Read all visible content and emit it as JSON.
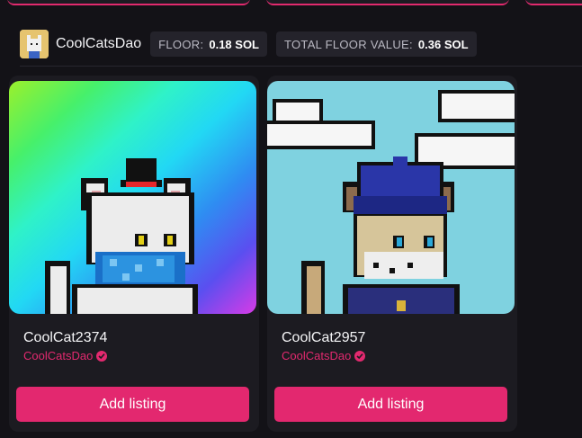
{
  "collection": {
    "name": "CoolCatsDao",
    "avatar_icon": "cool-cat-avatar",
    "stats": [
      {
        "label": "FLOOR:",
        "value": "0.18 SOL"
      },
      {
        "label": "TOTAL FLOOR VALUE:",
        "value": "0.36 SOL"
      }
    ]
  },
  "cards": [
    {
      "title": "CoolCat2374",
      "collection": "CoolCatsDao",
      "action": "Add listing"
    },
    {
      "title": "CoolCat2957",
      "collection": "CoolCatsDao",
      "action": "Add listing"
    }
  ],
  "colors": {
    "accent": "#e3286f",
    "background": "#131217",
    "card": "#1c1b21",
    "stat_chip": "#24232b"
  }
}
